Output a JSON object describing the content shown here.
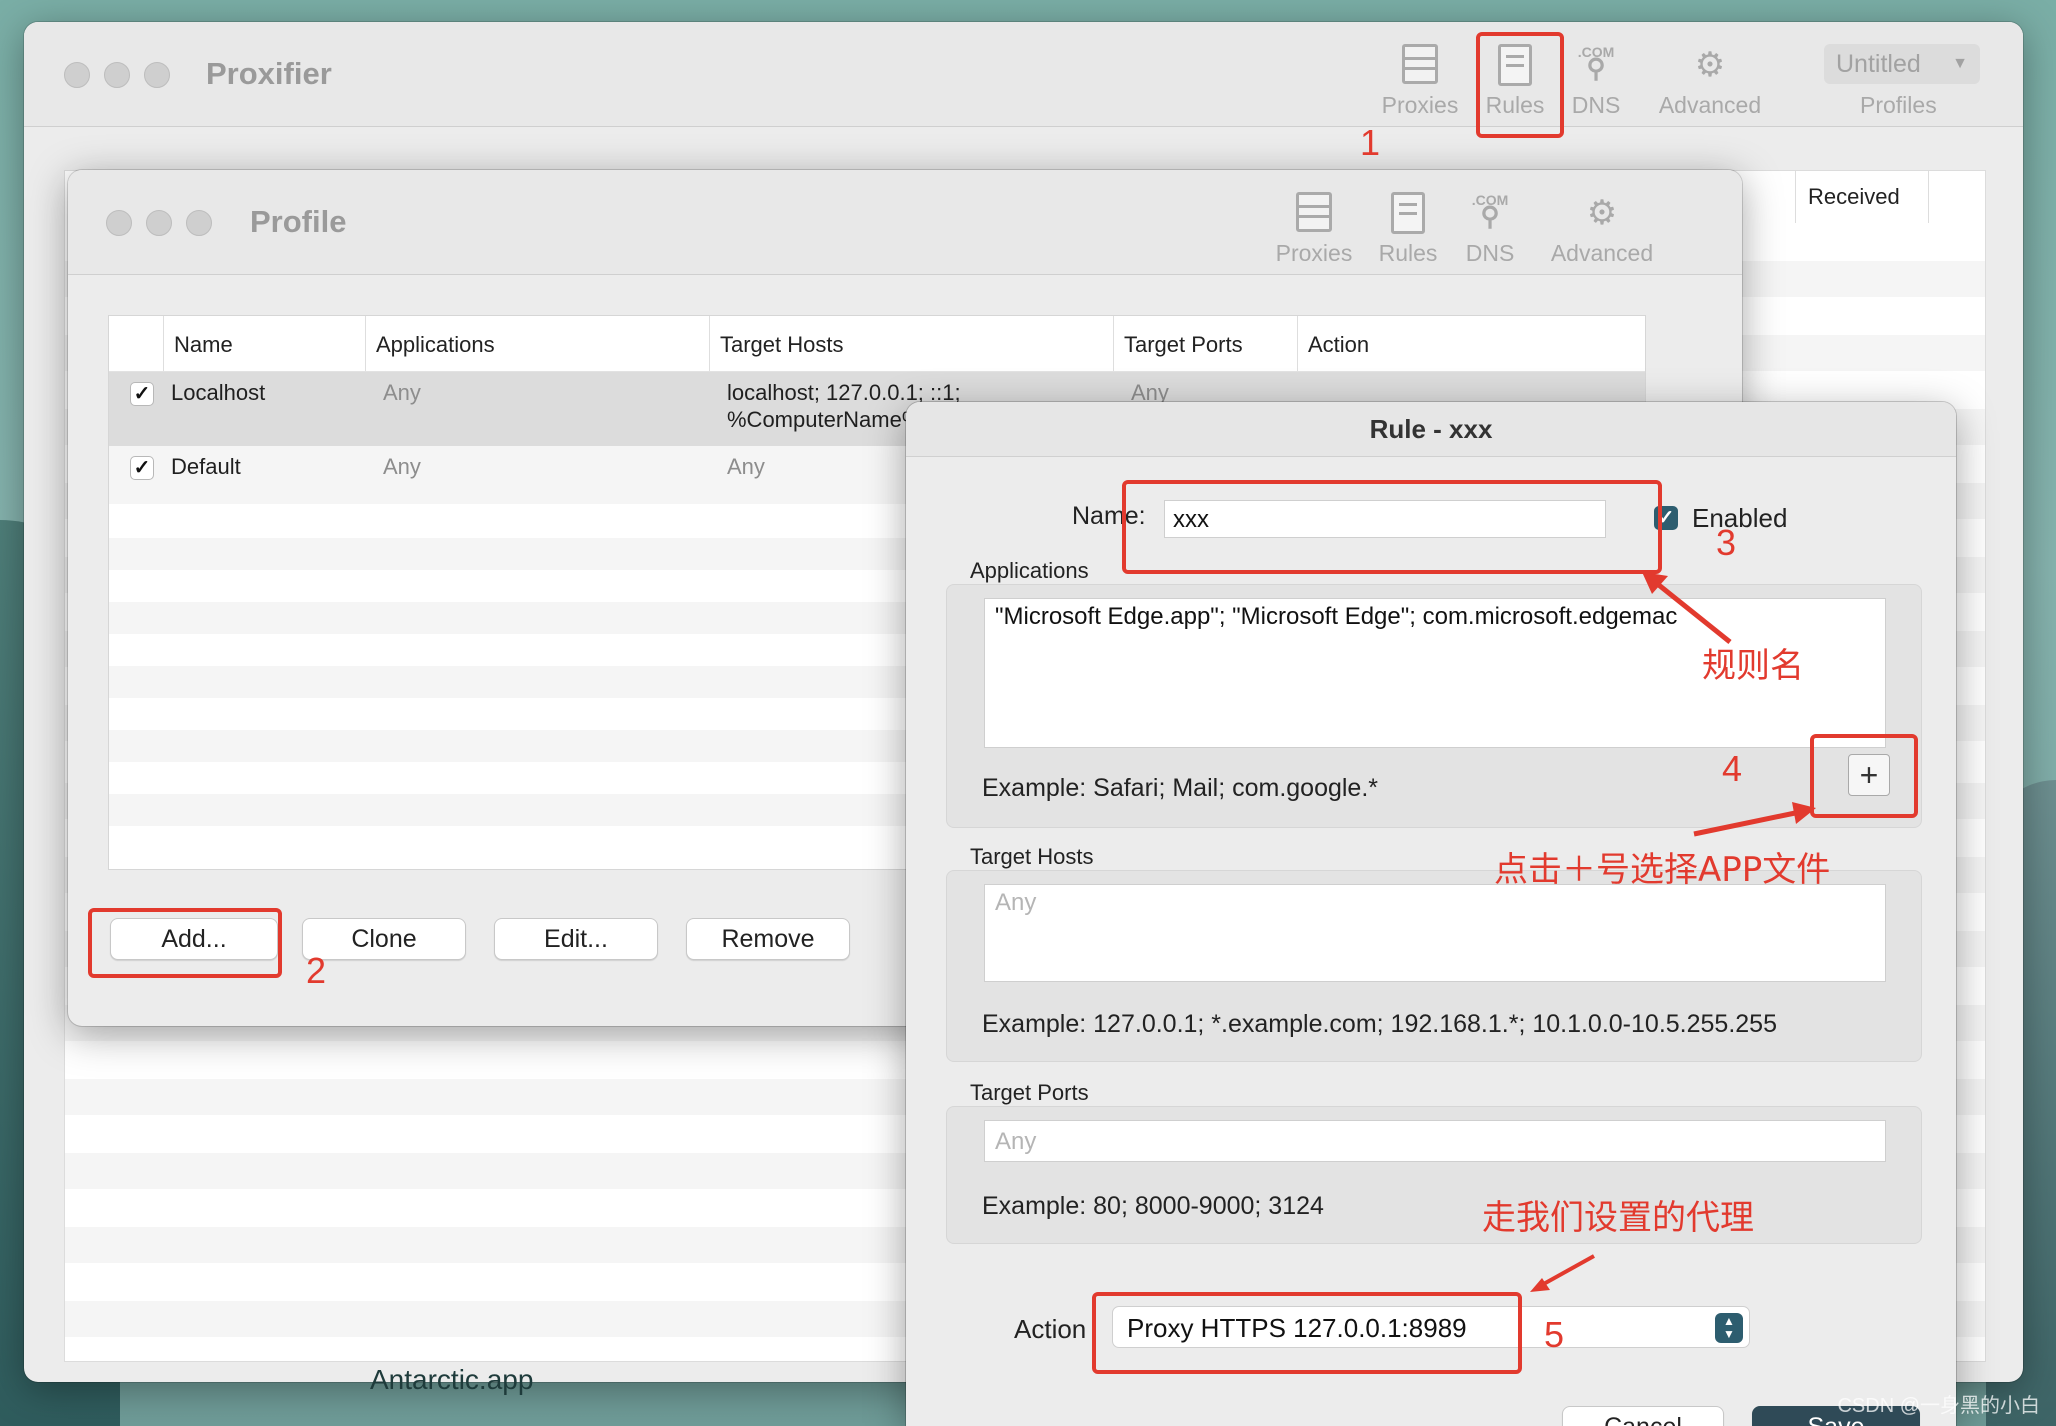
{
  "main_window": {
    "title": "Proxifier",
    "toolbar": [
      {
        "label": "Proxies",
        "icon": "server-icon"
      },
      {
        "label": "Rules",
        "icon": "document-icon"
      },
      {
        "label": "DNS",
        "icon": "dns-icon",
        "icon_text": ".COM"
      },
      {
        "label": "Advanced",
        "icon": "gear-icon"
      }
    ],
    "profile_select_value": "Untitled",
    "profile_select_label": "Profiles",
    "received_header": "Received",
    "bg_app_text": "Antarctic.app"
  },
  "profile_window": {
    "title": "Profile",
    "toolbar": [
      {
        "label": "Proxies",
        "icon": "server-icon"
      },
      {
        "label": "Rules",
        "icon": "document-icon"
      },
      {
        "label": "DNS",
        "icon": "dns-icon",
        "icon_text": ".COM"
      },
      {
        "label": "Advanced",
        "icon": "gear-icon"
      }
    ],
    "columns": [
      "Name",
      "Applications",
      "Target Hosts",
      "Target Ports",
      "Action"
    ],
    "rows": [
      {
        "enabled": true,
        "check": "✓",
        "name": "Localhost",
        "applications": "Any",
        "target_hosts_line1": "localhost; 127.0.0.1; ::1;",
        "target_hosts_line2": "%ComputerName%",
        "target_ports": "Any"
      },
      {
        "enabled": true,
        "check": "✓",
        "name": "Default",
        "applications": "Any",
        "target_hosts_line1": "Any",
        "target_ports": ""
      }
    ],
    "buttons": {
      "add": "Add...",
      "clone": "Clone",
      "edit": "Edit...",
      "remove": "Remove"
    }
  },
  "rule_sheet": {
    "title": "Rule - xxx",
    "name_label": "Name:",
    "name_value": "xxx",
    "enabled_label": "Enabled",
    "enabled_check": "✓",
    "applications_label": "Applications",
    "applications_value": "\"Microsoft Edge.app\"; \"Microsoft Edge\"; com.microsoft.edgemac",
    "applications_example": "Example: Safari; Mail; com.google.*",
    "add_app_button": "+",
    "target_hosts_label": "Target Hosts",
    "target_hosts_placeholder": "Any",
    "target_hosts_example": "Example: 127.0.0.1; *.example.com; 192.168.1.*; 10.1.0.0-10.5.255.255",
    "target_ports_label": "Target Ports",
    "target_ports_placeholder": "Any",
    "target_ports_example": "Example: 80; 8000-9000; 3124",
    "action_label": "Action",
    "action_value": "Proxy HTTPS 127.0.0.1:8989",
    "cancel_button": "Cancel",
    "save_button": "Save"
  },
  "annotations": {
    "step1": "1",
    "step2": "2",
    "step3": "3",
    "step4": "4",
    "step5": "5",
    "note_rule_name": "规则名",
    "note_add_app": "点击＋号选择APP文件",
    "note_proxy": "走我们设置的代理",
    "watermark": "CSDN @一身黑的小白"
  },
  "colors": {
    "annotation_red": "#e23a2e",
    "save_button": "#2f4a57"
  }
}
